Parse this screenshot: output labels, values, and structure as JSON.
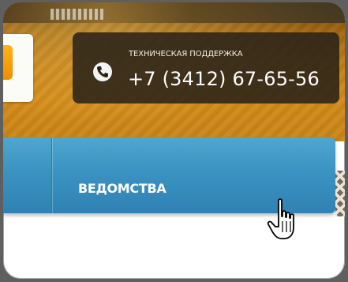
{
  "header": {
    "support": {
      "label": "ТЕХНИЧЕСКАЯ ПОДДЕРЖКА",
      "phone": "+7 (3412) 67-65-56",
      "icon": "phone-icon"
    }
  },
  "nav": {
    "items": [
      {
        "label": "ВЕДОМСТВА"
      }
    ]
  },
  "colors": {
    "nav_blue": "#3b93c2",
    "header_gold": "#c47f12",
    "panel_dark": "#262119"
  }
}
